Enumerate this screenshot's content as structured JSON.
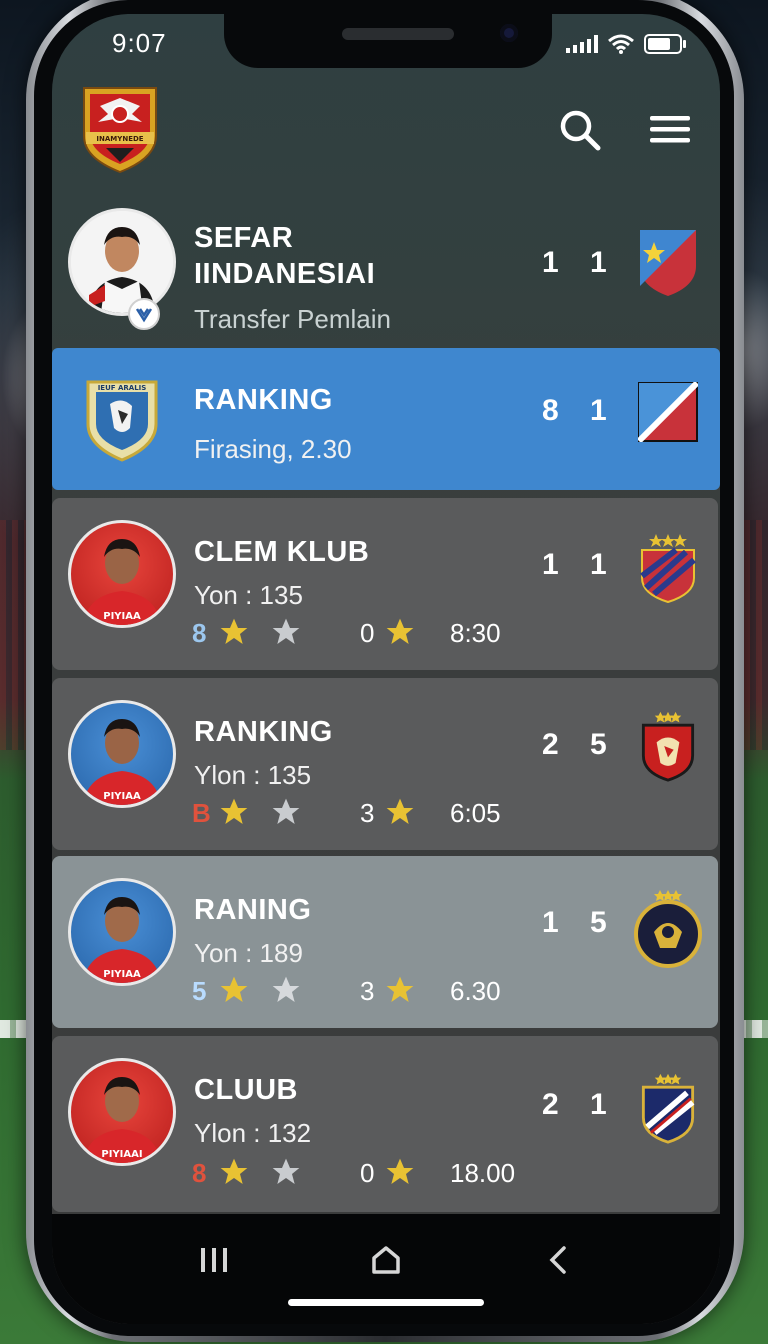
{
  "status_bar": {
    "time": "9:07",
    "icons": [
      "signal-icon",
      "wifi-icon",
      "battery-icon"
    ]
  },
  "header": {
    "logo": "club-crest-logo",
    "search_icon": "search-icon",
    "menu_icon": "hamburger-menu-icon",
    "logo_text": "INAMYNEDE"
  },
  "hero": {
    "title_line1": "SEFAR",
    "title_line2": "IINDANESIAI",
    "subtitle": "Transfer Pemlain",
    "score_left": "1",
    "score_right": "1"
  },
  "highlight": {
    "title": "RANKING",
    "subtitle": "Firasing, 2.30",
    "score_left": "8",
    "score_right": "1",
    "badge_text": "IEUF ARALIS"
  },
  "cards": [
    {
      "title": "CLEM KLUB",
      "subtitle": "Yon : 135",
      "stat_num": "8",
      "stat_color": "#9cc7ee",
      "second_num": "0",
      "time": "8:30",
      "score_left": "1",
      "score_right": "1",
      "jersey_text": "PIYIAA"
    },
    {
      "title": "RANKING",
      "subtitle": "Ylon : 135",
      "stat_num": "B",
      "stat_color": "#e0523d",
      "second_num": "3",
      "time": "6:05",
      "score_left": "2",
      "score_right": "5",
      "jersey_text": "PIYIAA"
    },
    {
      "title": "RANING",
      "subtitle": "Yon : 189",
      "stat_num": "5",
      "stat_color": "#b9dcff",
      "second_num": "3",
      "time": "6.30",
      "score_left": "1",
      "score_right": "5",
      "jersey_text": "PIYIAA"
    },
    {
      "title": "CLUUB",
      "subtitle": "Ylon : 132",
      "stat_num": "8",
      "stat_color": "#e0523d",
      "second_num": "0",
      "time": "18.00",
      "score_left": "2",
      "score_right": "1",
      "jersey_text": "PIYIAAI"
    }
  ],
  "nav": {
    "recents_icon": "recents-icon",
    "home_icon": "home-icon",
    "back_icon": "back-chevron-icon"
  }
}
